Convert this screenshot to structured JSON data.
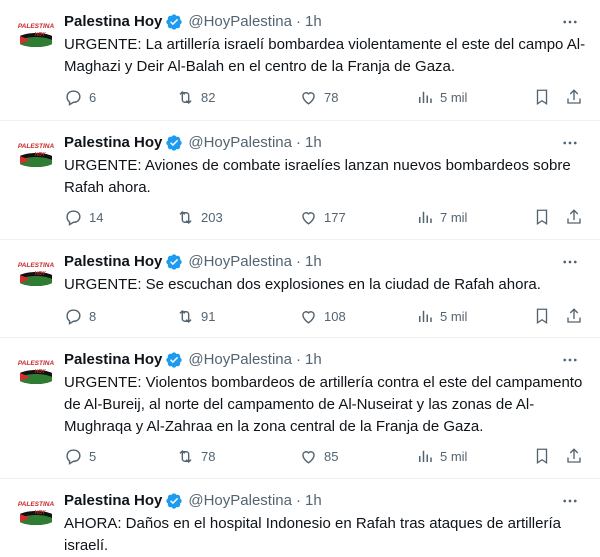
{
  "tweets": [
    {
      "name": "Palestina Hoy",
      "handle": "@HoyPalestina",
      "separator": "·",
      "time": "1h",
      "text": "URGENTE: La artillería israelí bombardea violentamente el este del campo Al-Maghazi y Deir Al-Balah en el centro de la Franja de Gaza.",
      "replies": "6",
      "reposts": "82",
      "likes": "78",
      "views": "5 mil"
    },
    {
      "name": "Palestina Hoy",
      "handle": "@HoyPalestina",
      "separator": "·",
      "time": "1h",
      "text": "URGENTE: Aviones de combate israelíes lanzan nuevos bombardeos sobre Rafah ahora.",
      "replies": "14",
      "reposts": "203",
      "likes": "177",
      "views": "7 mil"
    },
    {
      "name": "Palestina Hoy",
      "handle": "@HoyPalestina",
      "separator": "·",
      "time": "1h",
      "text": "URGENTE: Se escuchan dos explosiones en la ciudad de Rafah ahora.",
      "replies": "8",
      "reposts": "91",
      "likes": "108",
      "views": "5 mil"
    },
    {
      "name": "Palestina Hoy",
      "handle": "@HoyPalestina",
      "separator": "·",
      "time": "1h",
      "text": "URGENTE: Violentos bombardeos de artillería contra el este del campamento de Al-Bureij, al norte del campamento de Al-Nuseirat y las zonas de Al-Mughraqa y Al-Zahraa en la zona central de la Franja de Gaza.",
      "replies": "5",
      "reposts": "78",
      "likes": "85",
      "views": "5 mil"
    },
    {
      "name": "Palestina Hoy",
      "handle": "@HoyPalestina",
      "separator": "·",
      "time": "1h",
      "text": "AHORA: Daños en el hospital Indonesio en Rafah tras ataques de artillería israelí."
    }
  ],
  "avatar_logo": {
    "line1": "PALESTINA",
    "line2": "HOY"
  },
  "colors": {
    "text": "#0f1419",
    "secondary": "#536471",
    "verified": "#1d9bf0",
    "divider": "#eff3f4",
    "flag_red": "#d32f2f",
    "flag_green": "#2e7d32"
  }
}
